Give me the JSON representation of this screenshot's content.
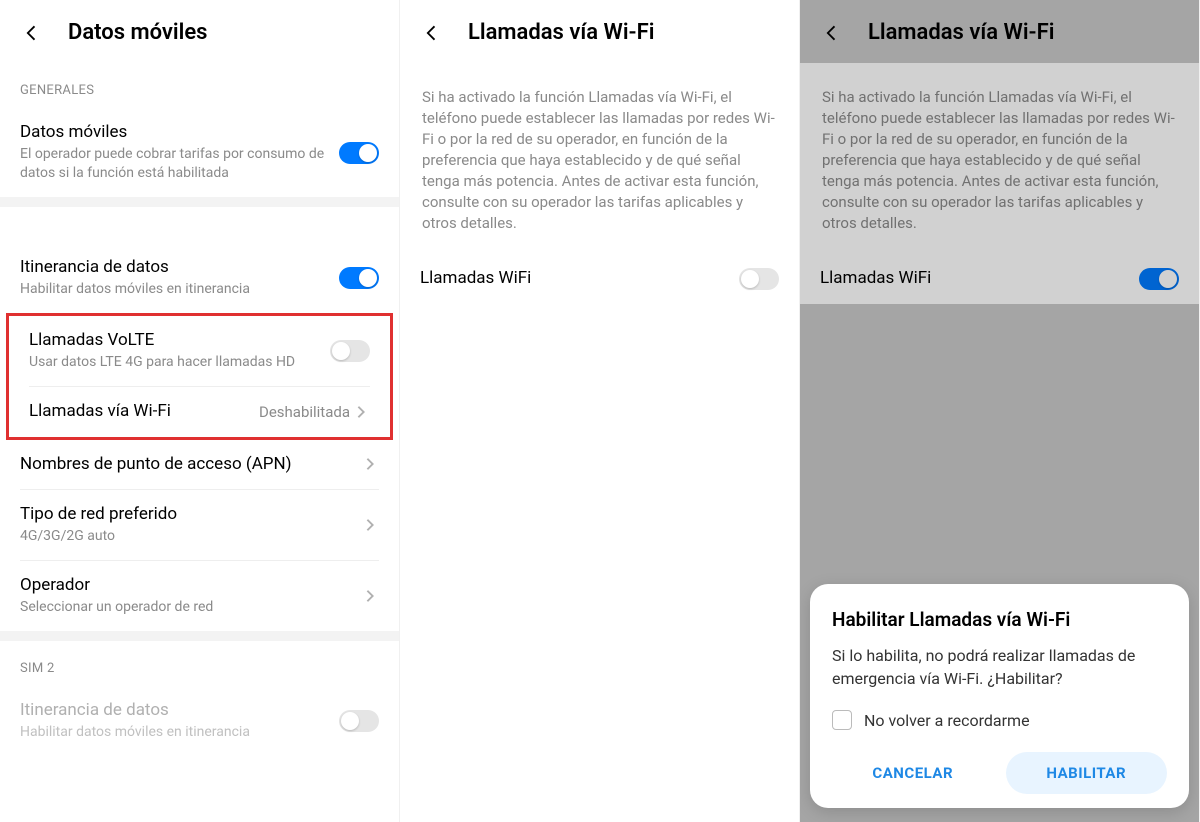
{
  "screen1": {
    "title": "Datos móviles",
    "section_generales": "GENERALES",
    "mobile_data": {
      "label": "Datos móviles",
      "sub": "El operador puede cobrar tarifas por consumo de datos si la función está habilitada"
    },
    "roaming": {
      "label": "Itinerancia de datos",
      "sub": "Habilitar datos móviles en itinerancia"
    },
    "volte": {
      "label": "Llamadas VoLTE",
      "sub": "Usar datos LTE 4G para hacer llamadas HD"
    },
    "wifi_call": {
      "label": "Llamadas vía Wi-Fi",
      "value": "Deshabilitada"
    },
    "apn": {
      "label": "Nombres de punto de acceso (APN)"
    },
    "net_type": {
      "label": "Tipo de red preferido",
      "sub": "4G/3G/2G auto"
    },
    "operator": {
      "label": "Operador",
      "sub": "Seleccionar un operador de red"
    },
    "sim2": "SIM 2",
    "roaming2": {
      "label": "Itinerancia de datos",
      "sub": "Habilitar datos móviles en itinerancia"
    }
  },
  "screen2": {
    "title": "Llamadas vía Wi-Fi",
    "info": "Si ha activado la función Llamadas vía Wi-Fi, el teléfono puede establecer las llamadas por redes Wi-Fi o por la red de su operador, en función de la preferencia que haya establecido y de qué señal tenga más potencia. Antes de activar esta función, consulte con su operador las tarifas aplicables y otros detalles.",
    "wifi_calls": "Llamadas WiFi"
  },
  "screen3": {
    "title": "Llamadas vía Wi-Fi",
    "info": "Si ha activado la función Llamadas vía Wi-Fi, el teléfono puede establecer las llamadas por redes Wi-Fi o por la red de su operador, en función de la preferencia que haya establecido y de qué señal tenga más potencia. Antes de activar esta función, consulte con su operador las tarifas aplicables y otros detalles.",
    "wifi_calls": "Llamadas WiFi",
    "dialog": {
      "title": "Habilitar Llamadas vía Wi-Fi",
      "body": "Si lo habilita, no podrá realizar llamadas de emergencia vía Wi-Fi. ¿Habilitar?",
      "remember": "No volver a recordarme",
      "cancel": "CANCELAR",
      "enable": "HABILITAR"
    }
  }
}
